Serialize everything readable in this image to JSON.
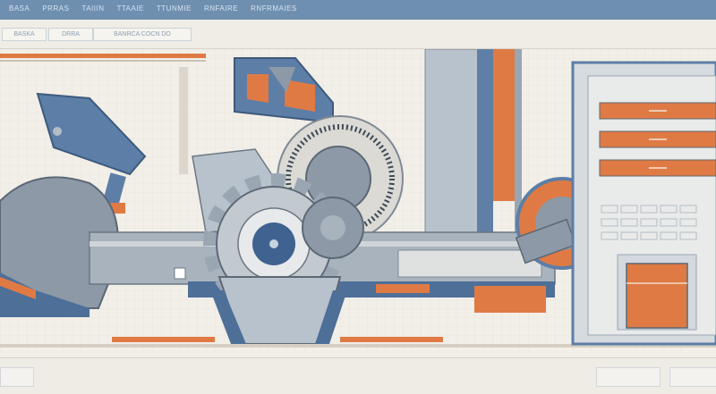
{
  "menubar": {
    "items": [
      "BASA",
      "PRRAS",
      "TAIIIN",
      "TTAAIE",
      "TTUNMIE",
      "RNFAIRE",
      "RNFRMAIES"
    ]
  },
  "toolbar": {
    "buttons": [
      "BASKA",
      "DRRA",
      "BANRCA COCN DO"
    ]
  },
  "palette": {
    "accent_blue": "#4d6f98",
    "accent_orange": "#e07a44",
    "steel_gray": "#8d99a6",
    "paper": "#f2efe8"
  },
  "panel": {
    "rows": 3,
    "drawer_label": ""
  },
  "statusbar": {
    "left": "",
    "right": [
      "",
      ""
    ]
  }
}
